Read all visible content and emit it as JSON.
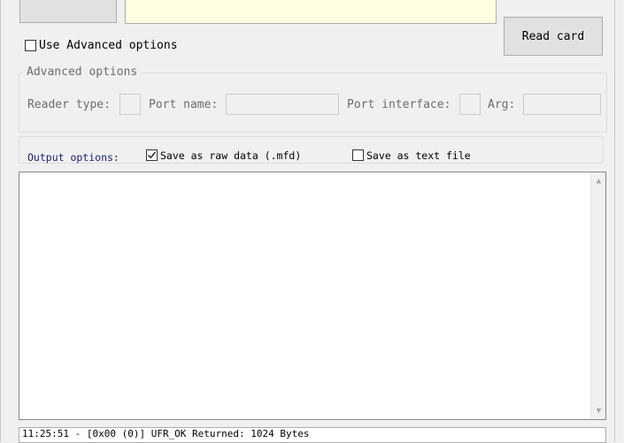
{
  "top": {
    "read_card_label": "Read card"
  },
  "advanced": {
    "use_advanced_label": "Use Advanced options",
    "use_advanced_checked": false,
    "group_title": "Advanced options",
    "reader_type_label": "Reader type:",
    "port_name_label": "Port name:",
    "port_interface_label": "Port interface:",
    "arg_label": "Arg:"
  },
  "output": {
    "label": "Output options:",
    "save_raw_label": "Save as raw data (.mfd)",
    "save_raw_checked": true,
    "save_text_label": "Save as text file",
    "save_text_checked": false
  },
  "status": {
    "text": "11:25:51 - [0x00 (0)] UFR_OK Returned: 1024 Bytes"
  },
  "colors": {
    "accent_label": "#1a1f6b",
    "field_yellow": "#ffffe1",
    "cursor_red": "#e01010"
  },
  "icons": [
    "checkbox-icon",
    "checkmark-icon",
    "scroll-up-arrow-icon",
    "scroll-down-arrow-icon",
    "mouse-pointer-icon"
  ]
}
